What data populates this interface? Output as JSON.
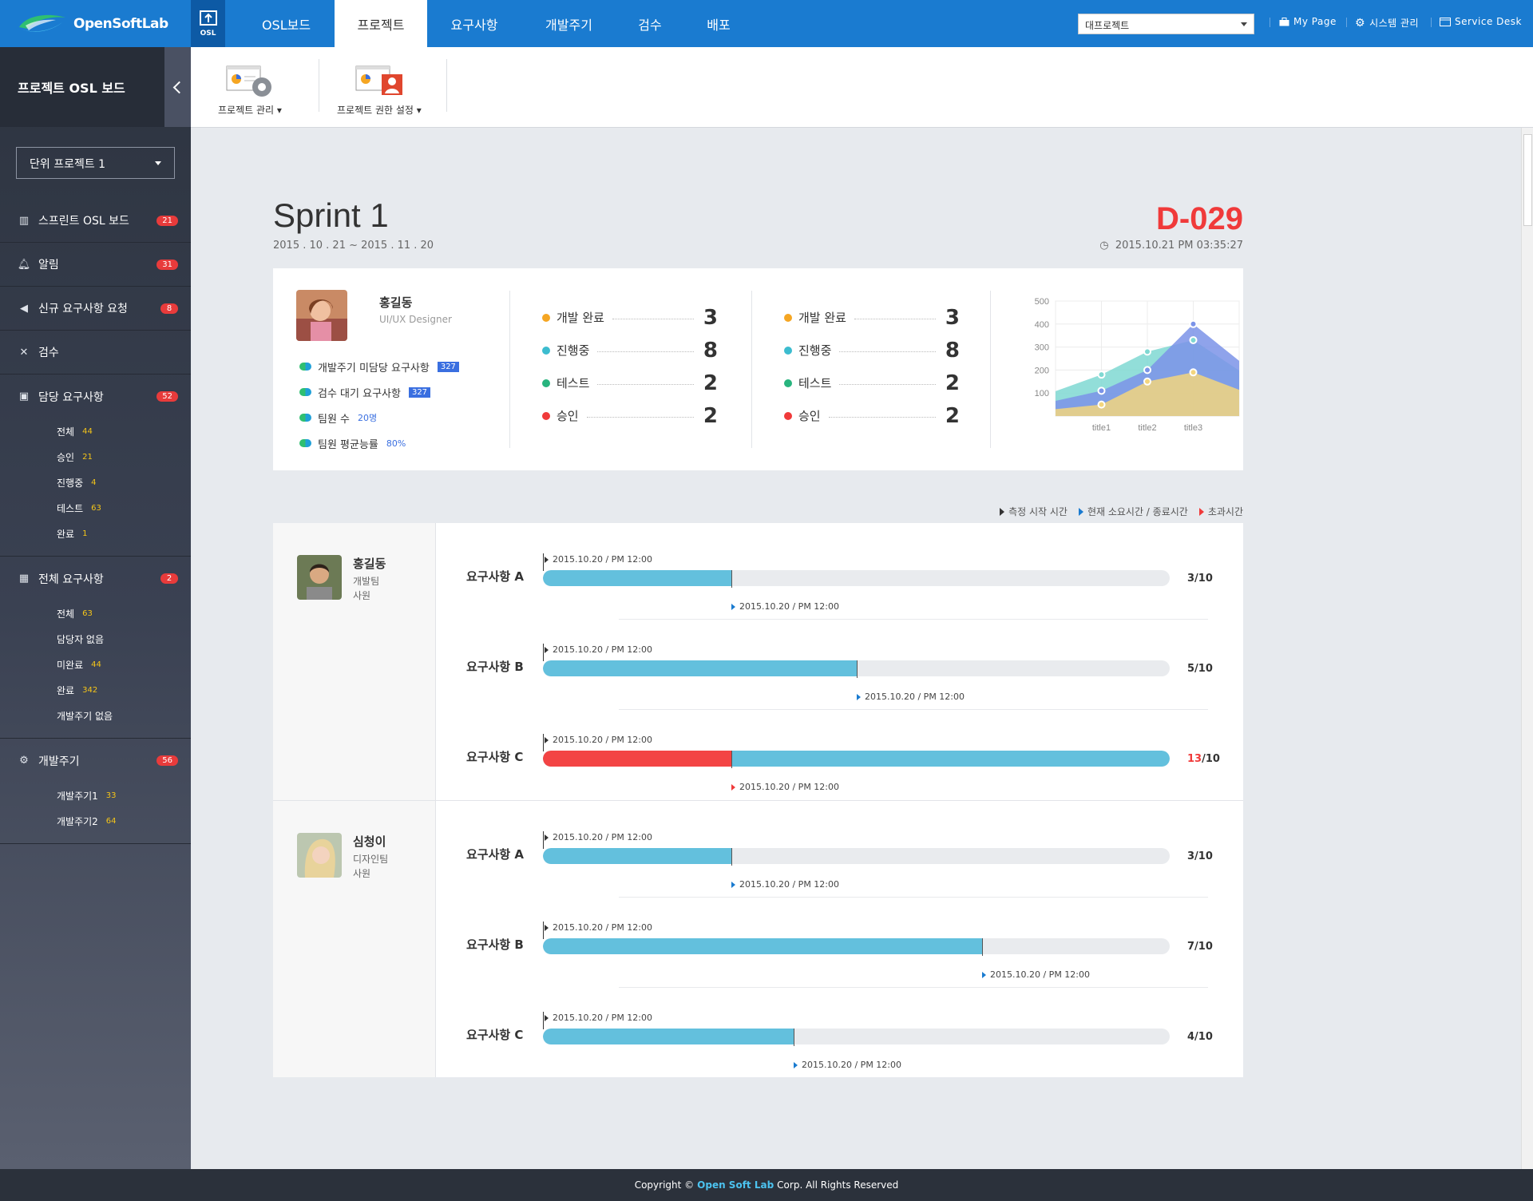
{
  "app": {
    "logo_text": "OpenSoftLab",
    "osl_label": "OSL"
  },
  "nav": {
    "tabs": [
      {
        "label": "OSL보드"
      },
      {
        "label": "프로젝트"
      },
      {
        "label": "요구사항"
      },
      {
        "label": "개발주기"
      },
      {
        "label": "검수"
      },
      {
        "label": "배포"
      }
    ],
    "active_tab": "프로젝트",
    "project_select": "대프로젝트",
    "links": {
      "mypage": "My Page",
      "system": "시스템 관리",
      "service": "Service Desk"
    }
  },
  "sidebar": {
    "title": "프로젝트 OSL 보드",
    "unit_select": "단위 프로젝트 1",
    "menu": [
      {
        "label": "스프린트 OSL 보드",
        "badge": "21",
        "icon": "board-icon"
      },
      {
        "label": "알림",
        "badge": "31",
        "icon": "bell-icon"
      },
      {
        "label": "신규 요구사항 요청",
        "badge": "8",
        "icon": "megaphone-icon"
      },
      {
        "label": "검수",
        "badge": "",
        "icon": "tools-icon"
      }
    ],
    "groups": [
      {
        "label": "담당 요구사항",
        "badge": "52",
        "icon": "briefcase-icon",
        "items": [
          {
            "label": "전체",
            "count": "44"
          },
          {
            "label": "승인",
            "count": "21"
          },
          {
            "label": "진행중",
            "count": "4"
          },
          {
            "label": "테스트",
            "count": "63"
          },
          {
            "label": "완료",
            "count": "1"
          }
        ]
      },
      {
        "label": "전체 요구사항",
        "badge": "2",
        "icon": "calendar-icon",
        "items": [
          {
            "label": "전체",
            "count": "63"
          },
          {
            "label": "담당자 없음",
            "count": ""
          },
          {
            "label": "미완료",
            "count": "44"
          },
          {
            "label": "완료",
            "count": "342"
          },
          {
            "label": "개발주기 없음",
            "count": ""
          }
        ]
      },
      {
        "label": "개발주기",
        "badge": "56",
        "icon": "gear-icon",
        "items": [
          {
            "label": "개발주기1",
            "count": "33"
          },
          {
            "label": "개발주기2",
            "count": "64"
          }
        ]
      }
    ]
  },
  "toolbar": {
    "tool1": "프로젝트 관리",
    "tool2": "프로젝트 권한 설정"
  },
  "sprint": {
    "title": "Sprint 1",
    "dates": "2015 . 10 . 21 ~ 2015 . 11 . 20",
    "dday": "D-029",
    "now": "2015.10.21   PM 03:35:27"
  },
  "profile": {
    "name": "홍길동",
    "role": "UI/UX Designer",
    "stats": [
      {
        "label": "개발주기 미담당 요구사항",
        "value": "327",
        "style": "box"
      },
      {
        "label": "검수 대기 요구사항",
        "value": "327",
        "style": "box"
      },
      {
        "label": "팀원 수",
        "value": "20명",
        "style": "text"
      },
      {
        "label": "팀원 평균능률",
        "value": "80%",
        "style": "text"
      }
    ]
  },
  "kpi_groups": [
    [
      {
        "label": "개발 완료",
        "value": "3",
        "color": "#f5a623"
      },
      {
        "label": "진행중",
        "value": "8",
        "color": "#3cbccf"
      },
      {
        "label": "테스트",
        "value": "2",
        "color": "#28b47e"
      },
      {
        "label": "승인",
        "value": "2",
        "color": "#f03a3a"
      }
    ],
    [
      {
        "label": "개발 완료",
        "value": "3",
        "color": "#f5a623"
      },
      {
        "label": "진행중",
        "value": "8",
        "color": "#3cbccf"
      },
      {
        "label": "테스트",
        "value": "2",
        "color": "#28b47e"
      },
      {
        "label": "승인",
        "value": "2",
        "color": "#f03a3a"
      }
    ]
  ],
  "chart_data": {
    "type": "area",
    "categories": [
      "title1",
      "title2",
      "title3"
    ],
    "y_ticks": [
      100,
      200,
      300,
      400,
      500
    ],
    "ylim": [
      0,
      500
    ],
    "series": [
      {
        "color": "#f2d57e",
        "values": [
          50,
          150,
          190
        ]
      },
      {
        "color": "#7b93e8",
        "values": [
          110,
          200,
          400
        ]
      },
      {
        "color": "#7fd8d2",
        "values": [
          180,
          280,
          330
        ]
      }
    ]
  },
  "legend": {
    "start": "측정 시작 시간",
    "current": "현재 소요시간 / 종료시간",
    "over": "초과시간"
  },
  "members": [
    {
      "name": "홍길동",
      "team": "개발팀",
      "rank": "사원",
      "reqs": [
        {
          "label": "요구사항 A",
          "start": "2015.10.20  /  PM 12:00",
          "end": "2015.10.20  /  PM 12:00",
          "progress": 3,
          "total": 10,
          "over": 0,
          "ratio": "3/10",
          "ratio_over": ""
        },
        {
          "label": "요구사항 B",
          "start": "2015.10.20  /  PM 12:00",
          "end": "2015.10.20  /  PM 12:00",
          "progress": 5,
          "total": 10,
          "over": 0,
          "ratio": "5/10",
          "ratio_over": ""
        },
        {
          "label": "요구사항 C",
          "start": "2015.10.20  /  PM 12:00",
          "end": "2015.10.20  /  PM 12:00",
          "progress": 13,
          "total": 10,
          "over": 3,
          "ratio": "/10",
          "ratio_over": "13"
        }
      ]
    },
    {
      "name": "심청이",
      "team": "디자인팀",
      "rank": "사원",
      "reqs": [
        {
          "label": "요구사항 A",
          "start": "2015.10.20  /  PM 12:00",
          "end": "2015.10.20  /  PM 12:00",
          "progress": 3,
          "total": 10,
          "over": 0,
          "ratio": "3/10",
          "ratio_over": ""
        },
        {
          "label": "요구사항 B",
          "start": "2015.10.20  /  PM 12:00",
          "end": "2015.10.20  /  PM 12:00",
          "progress": 7,
          "total": 10,
          "over": 0,
          "ratio": "7/10",
          "ratio_over": ""
        },
        {
          "label": "요구사항 C",
          "start": "2015.10.20  /  PM 12:00",
          "end": "2015.10.20  /  PM 12:00",
          "progress": 4,
          "total": 10,
          "over": 0,
          "ratio": "4/10",
          "ratio_over": ""
        }
      ]
    }
  ],
  "footer": {
    "pre": "Copyright ©",
    "brand": "Open Soft Lab",
    "post": "Corp. All Rights Reserved"
  }
}
